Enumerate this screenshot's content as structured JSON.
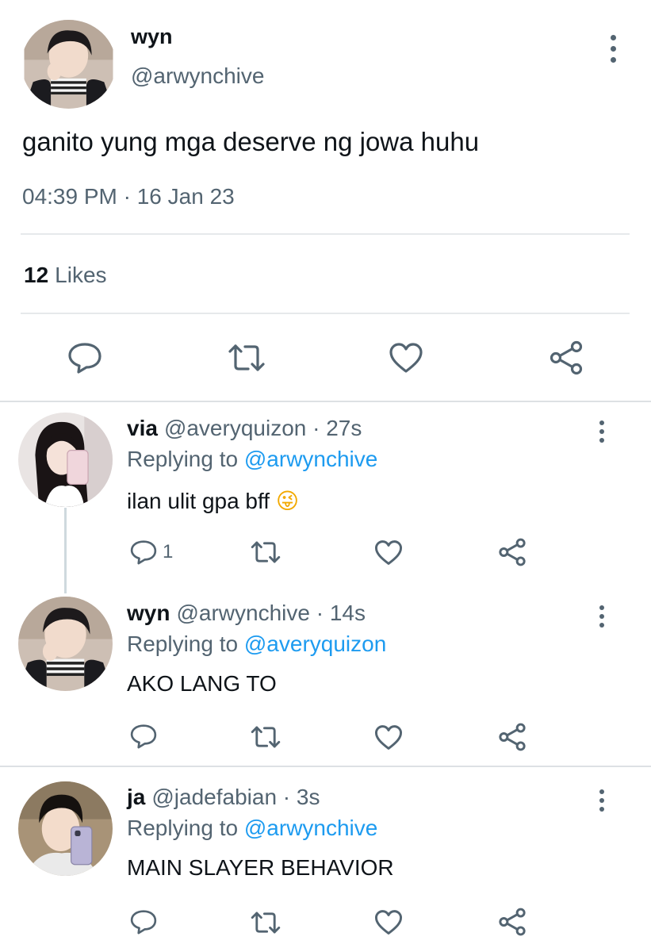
{
  "main_tweet": {
    "name": "wyn",
    "handle": "@arwynchive",
    "text": "ganito yung mga deserve ng jowa huhu",
    "timestamp": "04:39 PM · 16 Jan 23",
    "likes_count": "12",
    "likes_label": "Likes",
    "actions": [
      "reply-icon",
      "retweet-icon",
      "like-icon",
      "share-icon"
    ]
  },
  "replies": [
    {
      "name": "via",
      "meta": "@averyquizon · 27s",
      "replying_label": "Replying to",
      "replying_to": "@arwynchive",
      "text": "ilan ulit gpa bff",
      "emoji": "😜",
      "reply_count": "1"
    },
    {
      "name": "wyn",
      "meta": "@arwynchive · 14s",
      "replying_label": "Replying to",
      "replying_to": "@averyquizon",
      "text": "AKO LANG TO"
    },
    {
      "name": "ja",
      "meta": "@jadefabian · 3s",
      "replying_label": "Replying to",
      "replying_to": "@arwynchive",
      "text": "MAIN SLAYER BEHAVIOR"
    }
  ],
  "colors": {
    "text": "#0f1419",
    "muted": "#536471",
    "link": "#1d9bf0",
    "divider": "#e6e9eb"
  }
}
